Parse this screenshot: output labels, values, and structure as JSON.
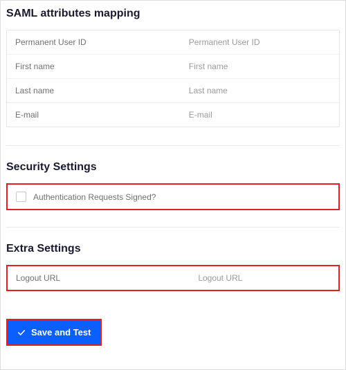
{
  "saml": {
    "title": "SAML attributes mapping",
    "rows": [
      {
        "label": "Permanent User ID",
        "placeholder": "Permanent User ID"
      },
      {
        "label": "First name",
        "placeholder": "First name"
      },
      {
        "label": "Last name",
        "placeholder": "Last name"
      },
      {
        "label": "E-mail",
        "placeholder": "E-mail"
      }
    ]
  },
  "security": {
    "title": "Security Settings",
    "auth_signed_label": "Authentication Requests Signed?"
  },
  "extra": {
    "title": "Extra Settings",
    "logout_label": "Logout URL",
    "logout_placeholder": "Logout URL"
  },
  "actions": {
    "save_test": "Save and Test"
  }
}
